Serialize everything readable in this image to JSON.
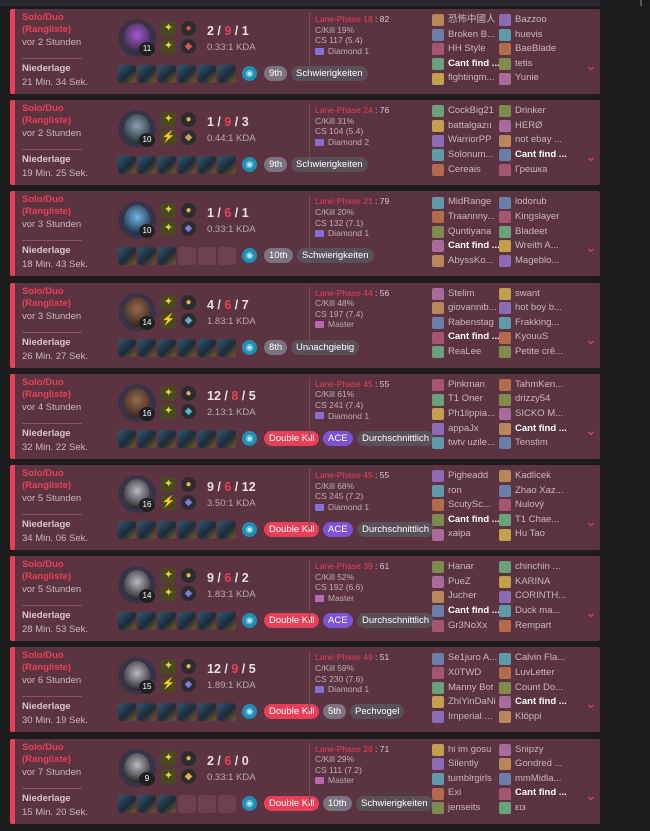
{
  "accent_loss": "#e84057",
  "icons": {
    "summoner_flash": "flash-icon",
    "summoner_ignite": "ignite-icon",
    "ward": "ward-icon",
    "expand": "chevron-down-icon"
  },
  "labels": {
    "lane_phase": "Lane-Phase",
    "ckill": "C/Kill",
    "cs": "CS"
  },
  "matches": [
    {
      "queue": "Solo/Duo (Rangliste)",
      "ago": "vor 2 Stunden",
      "result": "Niederlage",
      "duration": "21 Min. 34 Sek.",
      "level": "11",
      "k": "2",
      "d": "9",
      "a": "1",
      "ratio": "0.33:1 KDA",
      "lane_phase": "18",
      "lane_score": "82",
      "ckill": "C/Kill 19%",
      "cs": "CS 117 (5.4)",
      "tier": "Diamond 1",
      "badges": [
        "9th",
        "Schwierigkeiten"
      ],
      "blue": [
        "恐怖中國人",
        "Broken B...",
        "HH Style",
        "Cant find ...",
        "fightingm..."
      ],
      "red": [
        "Bazzoo",
        "huevis",
        "BaeBlade",
        "tetis",
        "Yunie"
      ],
      "me": "blue3"
    },
    {
      "queue": "Solo/Duo (Rangliste)",
      "ago": "vor 2 Stunden",
      "result": "Niederlage",
      "duration": "19 Min. 25 Sek.",
      "level": "10",
      "k": "1",
      "d": "9",
      "a": "3",
      "ratio": "0.44:1 KDA",
      "lane_phase": "24",
      "lane_score": "76",
      "ckill": "C/Kill 31%",
      "cs": "CS 104 (5.4)",
      "tier": "Diamond 2",
      "badges": [
        "9th",
        "Schwierigkeiten"
      ],
      "blue": [
        "CockBig21",
        "battalgazıı",
        "WarriorPP",
        "Solonum...",
        "Cereais"
      ],
      "red": [
        "Drinker",
        "HERØ",
        "not ebay ...",
        "Cant find ...",
        "Грешка"
      ],
      "me": "red3"
    },
    {
      "queue": "Solo/Duo (Rangliste)",
      "ago": "vor 3 Stunden",
      "result": "Niederlage",
      "duration": "18 Min. 43 Sek.",
      "level": "10",
      "k": "1",
      "d": "6",
      "a": "1",
      "ratio": "0.33:1 KDA",
      "lane_phase": "21",
      "lane_score": "79",
      "ckill": "C/Kill 20%",
      "cs": "CS 132 (7.1)",
      "tier": "Diamond 1",
      "badges": [
        "10th",
        "Schwierigkeiten"
      ],
      "blue": [
        "MidRange",
        "Traannny...",
        "Quntiyana",
        "Cant find ...",
        "AbyssKo..."
      ],
      "red": [
        "lodorub",
        "Kingslayer",
        "Bladeet",
        "Wreith A...",
        "Mageblo..."
      ],
      "me": "blue3"
    },
    {
      "queue": "Solo/Duo (Rangliste)",
      "ago": "vor 3 Stunden",
      "result": "Niederlage",
      "duration": "26 Min. 27 Sek.",
      "level": "14",
      "k": "4",
      "d": "6",
      "a": "7",
      "ratio": "1.83:1 KDA",
      "lane_phase": "44",
      "lane_score": "56",
      "ckill": "C/Kill 48%",
      "cs": "CS 197 (7.4)",
      "tier": "Master",
      "badges": [
        "8th",
        "Unnachgiebig"
      ],
      "blue": [
        "Stelim",
        "giovannib...",
        "Rabenstag",
        "Cant find ...",
        "ReaLee"
      ],
      "red": [
        "swant",
        "hot boy b...",
        "Frakking...",
        "KyouuS",
        "Petite crê..."
      ],
      "me": "blue3"
    },
    {
      "queue": "Solo/Duo (Rangliste)",
      "ago": "vor 4 Stunden",
      "result": "Niederlage",
      "duration": "32 Min. 22 Sek.",
      "level": "16",
      "k": "12",
      "d": "8",
      "a": "5",
      "ratio": "2.13:1 KDA",
      "lane_phase": "45",
      "lane_score": "55",
      "ckill": "C/Kill 61%",
      "cs": "CS 241 (7.4)",
      "tier": "Diamond 1",
      "badges": [
        "Double Kill",
        "ACE",
        "Durchschnittlich"
      ],
      "blue": [
        "Pinkman",
        "T1 Oner",
        "Ph1lippia...",
        "appaJx",
        "twtv uzile..."
      ],
      "red": [
        "TahmKen...",
        "drizzy54",
        "SICKO M...",
        "Cant find ...",
        "Tenstim"
      ],
      "me": "red3"
    },
    {
      "queue": "Solo/Duo (Rangliste)",
      "ago": "vor 5 Stunden",
      "result": "Niederlage",
      "duration": "34 Min. 06 Sek.",
      "level": "16",
      "k": "9",
      "d": "6",
      "a": "12",
      "ratio": "3.50:1 KDA",
      "lane_phase": "45",
      "lane_score": "55",
      "ckill": "C/Kill 68%",
      "cs": "CS 245 (7.2)",
      "tier": "Diamond 1",
      "badges": [
        "Double Kill",
        "ACE",
        "Durchschnittlich"
      ],
      "blue": [
        "Pigheadd",
        "ron",
        "ScutySc...",
        "Cant find ...",
        "xaipa"
      ],
      "red": [
        "Kadlicek",
        "Zhao Xaz...",
        "Nulový",
        "T1 Chae...",
        "Hu Tao"
      ],
      "me": "blue3"
    },
    {
      "queue": "Solo/Duo (Rangliste)",
      "ago": "vor 5 Stunden",
      "result": "Niederlage",
      "duration": "28 Min. 53 Sek.",
      "level": "14",
      "k": "9",
      "d": "6",
      "a": "2",
      "ratio": "1.83:1 KDA",
      "lane_phase": "39",
      "lane_score": "61",
      "ckill": "C/Kill 52%",
      "cs": "CS 192 (6.6)",
      "tier": "Master",
      "badges": [
        "Double Kill",
        "ACE",
        "Durchschnittlich"
      ],
      "blue": [
        "Hanar",
        "PueZ",
        "Jucher",
        "Cant find ...",
        "Gr3NoXx"
      ],
      "red": [
        "chinchin ...",
        "KARINA",
        "CORINTH...",
        "Duck ma...",
        "Rempart"
      ],
      "me": "blue3"
    },
    {
      "queue": "Solo/Duo (Rangliste)",
      "ago": "vor 6 Stunden",
      "result": "Niederlage",
      "duration": "30 Min. 19 Sek.",
      "level": "15",
      "k": "12",
      "d": "9",
      "a": "5",
      "ratio": "1.89:1 KDA",
      "lane_phase": "49",
      "lane_score": "51",
      "ckill": "C/Kill 59%",
      "cs": "CS 230 (7.6)",
      "tier": "Diamond 1",
      "badges": [
        "Double Kill",
        "5th",
        "Pechvogel"
      ],
      "blue": [
        "Se1juro A...",
        "X0TWD",
        "Manny Bot",
        "ZhiYinDaNi",
        "Imperial ..."
      ],
      "red": [
        "Calvin Fla...",
        "LuvLetter",
        "Count Do...",
        "Cant find ...",
        "Klöppi"
      ],
      "me": "red3"
    },
    {
      "queue": "Solo/Duo (Rangliste)",
      "ago": "vor 7 Stunden",
      "result": "Niederlage",
      "duration": "15 Min. 20 Sek.",
      "level": "9",
      "k": "2",
      "d": "6",
      "a": "0",
      "ratio": "0.33:1 KDA",
      "lane_phase": "29",
      "lane_score": "71",
      "ckill": "C/Kill 29%",
      "cs": "CS 111 (7.2)",
      "tier": "Master",
      "badges": [
        "Double Kill",
        "10th",
        "Schwierigkeiten"
      ],
      "blue": [
        "hi im gosu",
        "Silently",
        "tumblrgirls",
        "Exi",
        "jenseits"
      ],
      "red": [
        "Snipzy",
        "Gondred ...",
        "mmMidla...",
        "Cant find ...",
        "ειз"
      ],
      "me": "red3"
    }
  ]
}
